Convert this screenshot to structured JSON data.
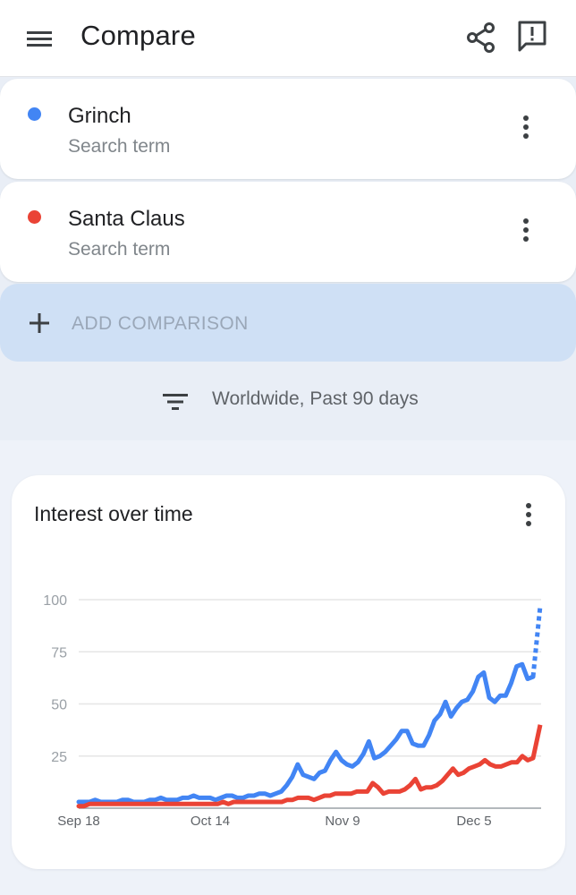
{
  "app_bar": {
    "title": "Compare",
    "icons": [
      "menu-icon",
      "share-icon",
      "feedback-icon"
    ]
  },
  "terms": [
    {
      "name": "Grinch",
      "subtitle": "Search term",
      "color": "#4285f4"
    },
    {
      "name": "Santa Claus",
      "subtitle": "Search term",
      "color": "#ea4335"
    }
  ],
  "add_comparison": {
    "label": "ADD COMPARISON"
  },
  "filter": {
    "label": "Worldwide, Past 90 days"
  },
  "chart_card": {
    "title": "Interest over time"
  },
  "chart_data": {
    "type": "line",
    "title": "Interest over time",
    "x_ticks": [
      "Sep 18",
      "Oct 14",
      "Nov 9",
      "Dec 5"
    ],
    "y_ticks": [
      100,
      75,
      50,
      25
    ],
    "ylim": [
      0,
      100
    ],
    "grid": true,
    "colors": {
      "Grinch": "#4285f4",
      "Santa Claus": "#ea4335"
    },
    "series": [
      {
        "name": "Grinch",
        "values": [
          3,
          3,
          3,
          4,
          3,
          3,
          3,
          3,
          4,
          4,
          3,
          3,
          3,
          4,
          4,
          5,
          4,
          4,
          4,
          5,
          5,
          6,
          5,
          5,
          5,
          4,
          5,
          6,
          6,
          5,
          5,
          6,
          6,
          7,
          7,
          6,
          7,
          8,
          11,
          15,
          21,
          16,
          15,
          14,
          17,
          18,
          23,
          27,
          23,
          21,
          20,
          22,
          26,
          32,
          24,
          25,
          27,
          30,
          33,
          37,
          37,
          31,
          30,
          30,
          35,
          42,
          45,
          51,
          44,
          48,
          51,
          52,
          56,
          63,
          65,
          53,
          51,
          54,
          54,
          60,
          68,
          69,
          62,
          63
        ],
        "partial_tail": [
          63,
          97
        ]
      },
      {
        "name": "Santa Claus",
        "values": [
          1,
          1,
          2,
          2,
          2,
          2,
          2,
          2,
          2,
          2,
          2,
          2,
          2,
          2,
          2,
          2,
          2,
          2,
          2,
          2,
          2,
          2,
          2,
          2,
          2,
          2,
          2,
          3,
          2,
          3,
          3,
          3,
          3,
          3,
          3,
          3,
          3,
          3,
          3,
          4,
          4,
          5,
          5,
          5,
          4,
          5,
          6,
          6,
          7,
          7,
          7,
          7,
          8,
          8,
          8,
          12,
          10,
          7,
          8,
          8,
          8,
          9,
          11,
          14,
          9,
          10,
          10,
          11,
          13,
          16,
          19,
          16,
          17,
          19,
          20,
          21,
          23,
          21,
          20,
          20,
          21,
          22,
          22,
          25,
          23,
          24
        ],
        "partial_tail": [
          24,
          40
        ]
      }
    ]
  }
}
